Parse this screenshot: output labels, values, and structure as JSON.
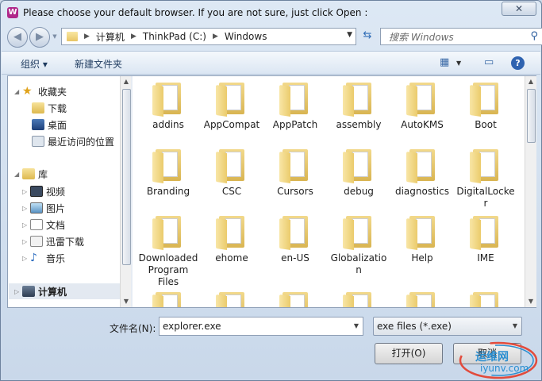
{
  "window": {
    "title": "Please choose your default browser. If you are not sure, just click Open :",
    "app_icon": "W",
    "close_label": "✕"
  },
  "nav": {
    "back_icon": "arrow-left-icon",
    "forward_icon": "arrow-right-icon",
    "breadcrumbs": [
      "计算机",
      "ThinkPad (C:)",
      "Windows"
    ],
    "search_placeholder": "搜索 Windows"
  },
  "toolbar": {
    "organize_label": "组织 ▾",
    "new_folder_label": "新建文件夹"
  },
  "sidebar": {
    "favorites_label": "收藏夹",
    "favorites": [
      "下载",
      "桌面",
      "最近访问的位置"
    ],
    "libraries_label": "库",
    "libraries": [
      "视频",
      "图片",
      "文档",
      "迅雷下载",
      "音乐"
    ],
    "computer_label": "计算机"
  },
  "files": [
    "addins",
    "AppCompat",
    "AppPatch",
    "assembly",
    "AutoKMS",
    "Boot",
    "Branding",
    "CSC",
    "Cursors",
    "debug",
    "diagnostics",
    "DigitalLocker",
    "Downloaded Program Files",
    "ehome",
    "en-US",
    "Globalization",
    "Help",
    "IME",
    "",
    "",
    "",
    "",
    "",
    ""
  ],
  "footer": {
    "filename_label": "文件名(N):",
    "filename_value": "explorer.exe",
    "filetype_value": "exe files (*.exe)",
    "open_label": "打开(O)",
    "cancel_label": "取消"
  },
  "watermark": {
    "top": "运维网",
    "bottom": "iyunv.com"
  },
  "colors": {
    "folder": "#e8c565",
    "accent": "#2d6bb5",
    "app_icon": "#b0288a"
  }
}
